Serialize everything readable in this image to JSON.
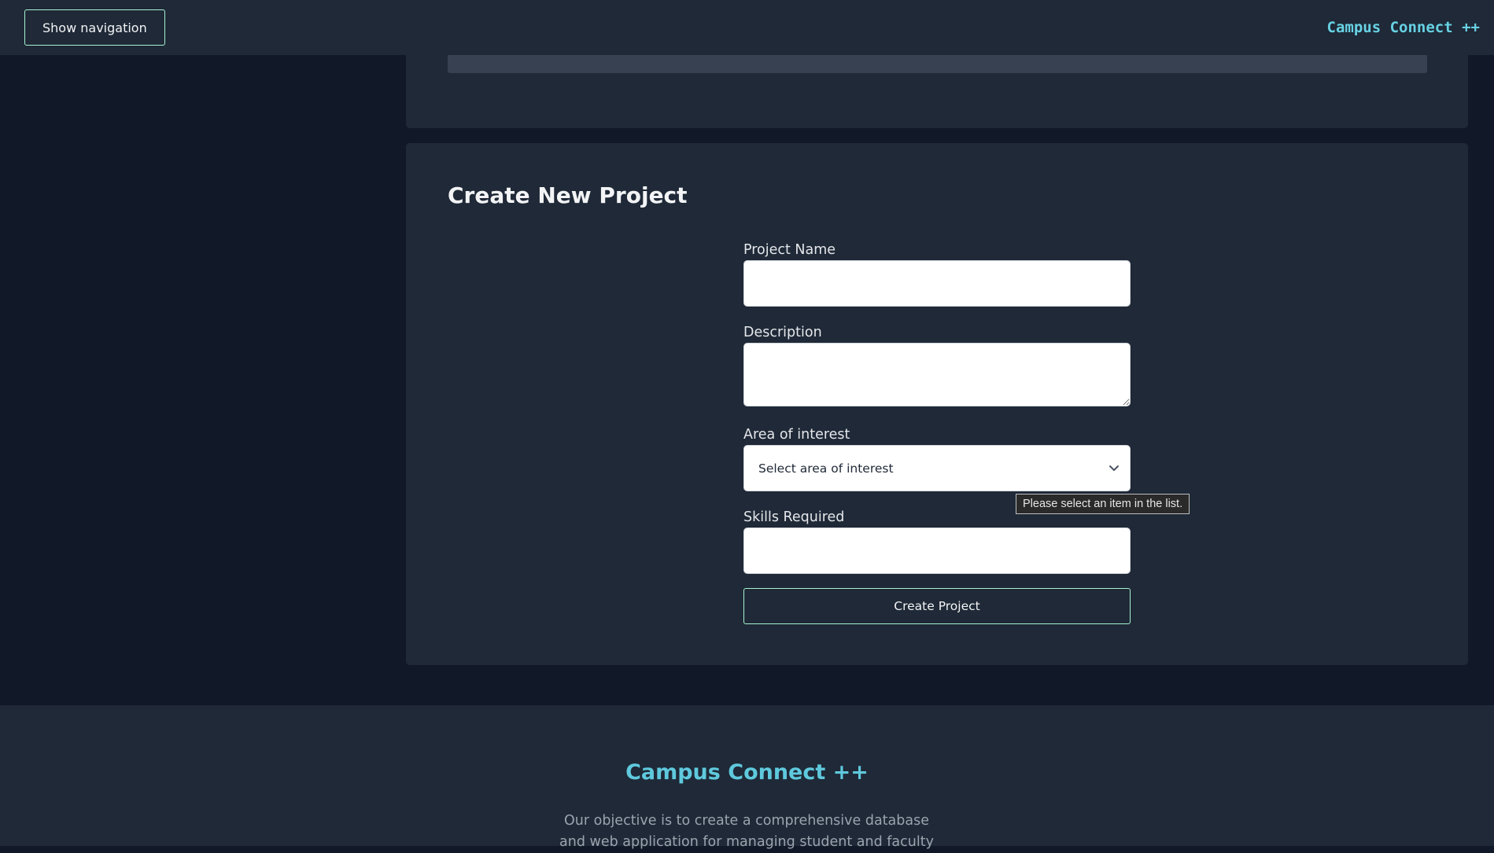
{
  "header": {
    "nav_button_label": "Show navigation",
    "brand": "Campus Connect ++"
  },
  "form": {
    "title": "Create New Project",
    "project_name_label": "Project Name",
    "project_name_value": "",
    "description_label": "Description",
    "description_value": "",
    "area_label": "Area of interest",
    "area_selected": "Select area of interest",
    "validation_tooltip": "Please select an item in the list.",
    "skills_label": "Skills Required",
    "skills_value": "",
    "submit_label": "Create Project"
  },
  "footer": {
    "title": "Campus Connect ++",
    "text": "Our objective is to create a comprehensive database and web application for managing student and faculty"
  },
  "colors": {
    "background": "#111827",
    "panel": "#1f2937",
    "accent": "#67d2e4",
    "button_border": "#a7f3d0"
  },
  "icons": {
    "select_arrow": "chevron-down-icon"
  }
}
